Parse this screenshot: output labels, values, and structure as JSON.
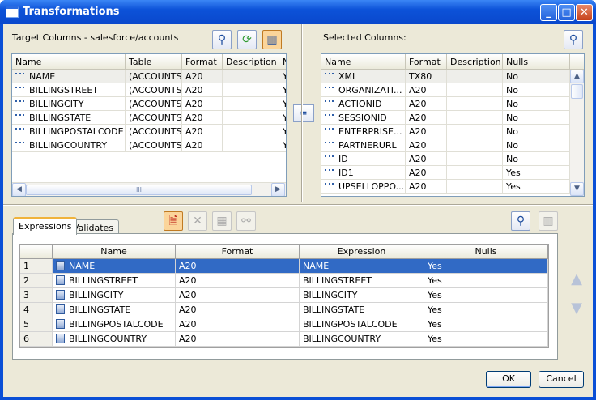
{
  "window": {
    "title": "Transformations"
  },
  "left": {
    "label": "Target Columns - salesforce/accounts",
    "columns": [
      "Name",
      "Table",
      "Format",
      "Description",
      "N"
    ],
    "rows": [
      {
        "name": "NAME",
        "table": "(ACCOUNTS)",
        "format": "A20",
        "description": "",
        "n": "Y"
      },
      {
        "name": "BILLINGSTREET",
        "table": "(ACCOUNTS)",
        "format": "A20",
        "description": "",
        "n": "Y"
      },
      {
        "name": "BILLINGCITY",
        "table": "(ACCOUNTS)",
        "format": "A20",
        "description": "",
        "n": "Y"
      },
      {
        "name": "BILLINGSTATE",
        "table": "(ACCOUNTS)",
        "format": "A20",
        "description": "",
        "n": "Y"
      },
      {
        "name": "BILLINGPOSTALCODE",
        "table": "(ACCOUNTS)",
        "format": "A20",
        "description": "",
        "n": "Y"
      },
      {
        "name": "BILLINGCOUNTRY",
        "table": "(ACCOUNTS)",
        "format": "A20",
        "description": "",
        "n": "Y"
      }
    ],
    "scroll_grip": "III"
  },
  "equals_label": "=",
  "right": {
    "label": "Selected Columns:",
    "columns": [
      "Name",
      "Format",
      "Description",
      "Nulls"
    ],
    "rows": [
      {
        "name": "XML",
        "format": "TX80",
        "description": "",
        "nulls": "No"
      },
      {
        "name": "ORGANIZATI...",
        "format": "A20",
        "description": "",
        "nulls": "No"
      },
      {
        "name": "ACTIONID",
        "format": "A20",
        "description": "",
        "nulls": "No"
      },
      {
        "name": "SESSIONID",
        "format": "A20",
        "description": "",
        "nulls": "No"
      },
      {
        "name": "ENTERPRISE...",
        "format": "A20",
        "description": "",
        "nulls": "No"
      },
      {
        "name": "PARTNERURL",
        "format": "A20",
        "description": "",
        "nulls": "No"
      },
      {
        "name": "ID",
        "format": "A20",
        "description": "",
        "nulls": "No"
      },
      {
        "name": "ID1",
        "format": "A20",
        "description": "",
        "nulls": "Yes"
      },
      {
        "name": "UPSELLOPPO...",
        "format": "A20",
        "description": "",
        "nulls": "Yes"
      }
    ]
  },
  "tabs": [
    "Expressions",
    "Validates"
  ],
  "expressions": {
    "columns": [
      "Name",
      "Format",
      "Expression",
      "Nulls"
    ],
    "rows": [
      {
        "num": "1",
        "name": "NAME",
        "format": "A20",
        "expression": "NAME",
        "nulls": "Yes"
      },
      {
        "num": "2",
        "name": "BILLINGSTREET",
        "format": "A20",
        "expression": "BILLINGSTREET",
        "nulls": "Yes"
      },
      {
        "num": "3",
        "name": "BILLINGCITY",
        "format": "A20",
        "expression": "BILLINGCITY",
        "nulls": "Yes"
      },
      {
        "num": "4",
        "name": "BILLINGSTATE",
        "format": "A20",
        "expression": "BILLINGSTATE",
        "nulls": "Yes"
      },
      {
        "num": "5",
        "name": "BILLINGPOSTALCODE",
        "format": "A20",
        "expression": "BILLINGPOSTALCODE",
        "nulls": "Yes"
      },
      {
        "num": "6",
        "name": "BILLINGCOUNTRY",
        "format": "A20",
        "expression": "BILLINGCOUNTRY",
        "nulls": "Yes"
      }
    ]
  },
  "buttons": {
    "ok": "OK",
    "cancel": "Cancel"
  },
  "icons": {
    "title_bar": [
      "minimize-icon",
      "maximize-icon",
      "close-icon"
    ],
    "toolbar": [
      "binoculars-icon",
      "refresh-icon",
      "columns-icon",
      "delete-icon",
      "clear-icon",
      "grid-icon",
      "link-icon",
      "move-up-icon",
      "move-down-icon"
    ]
  },
  "colors": {
    "title_bar": "#0a4fd6",
    "selection": "#316ac5",
    "dialog": "#ece9d8"
  }
}
